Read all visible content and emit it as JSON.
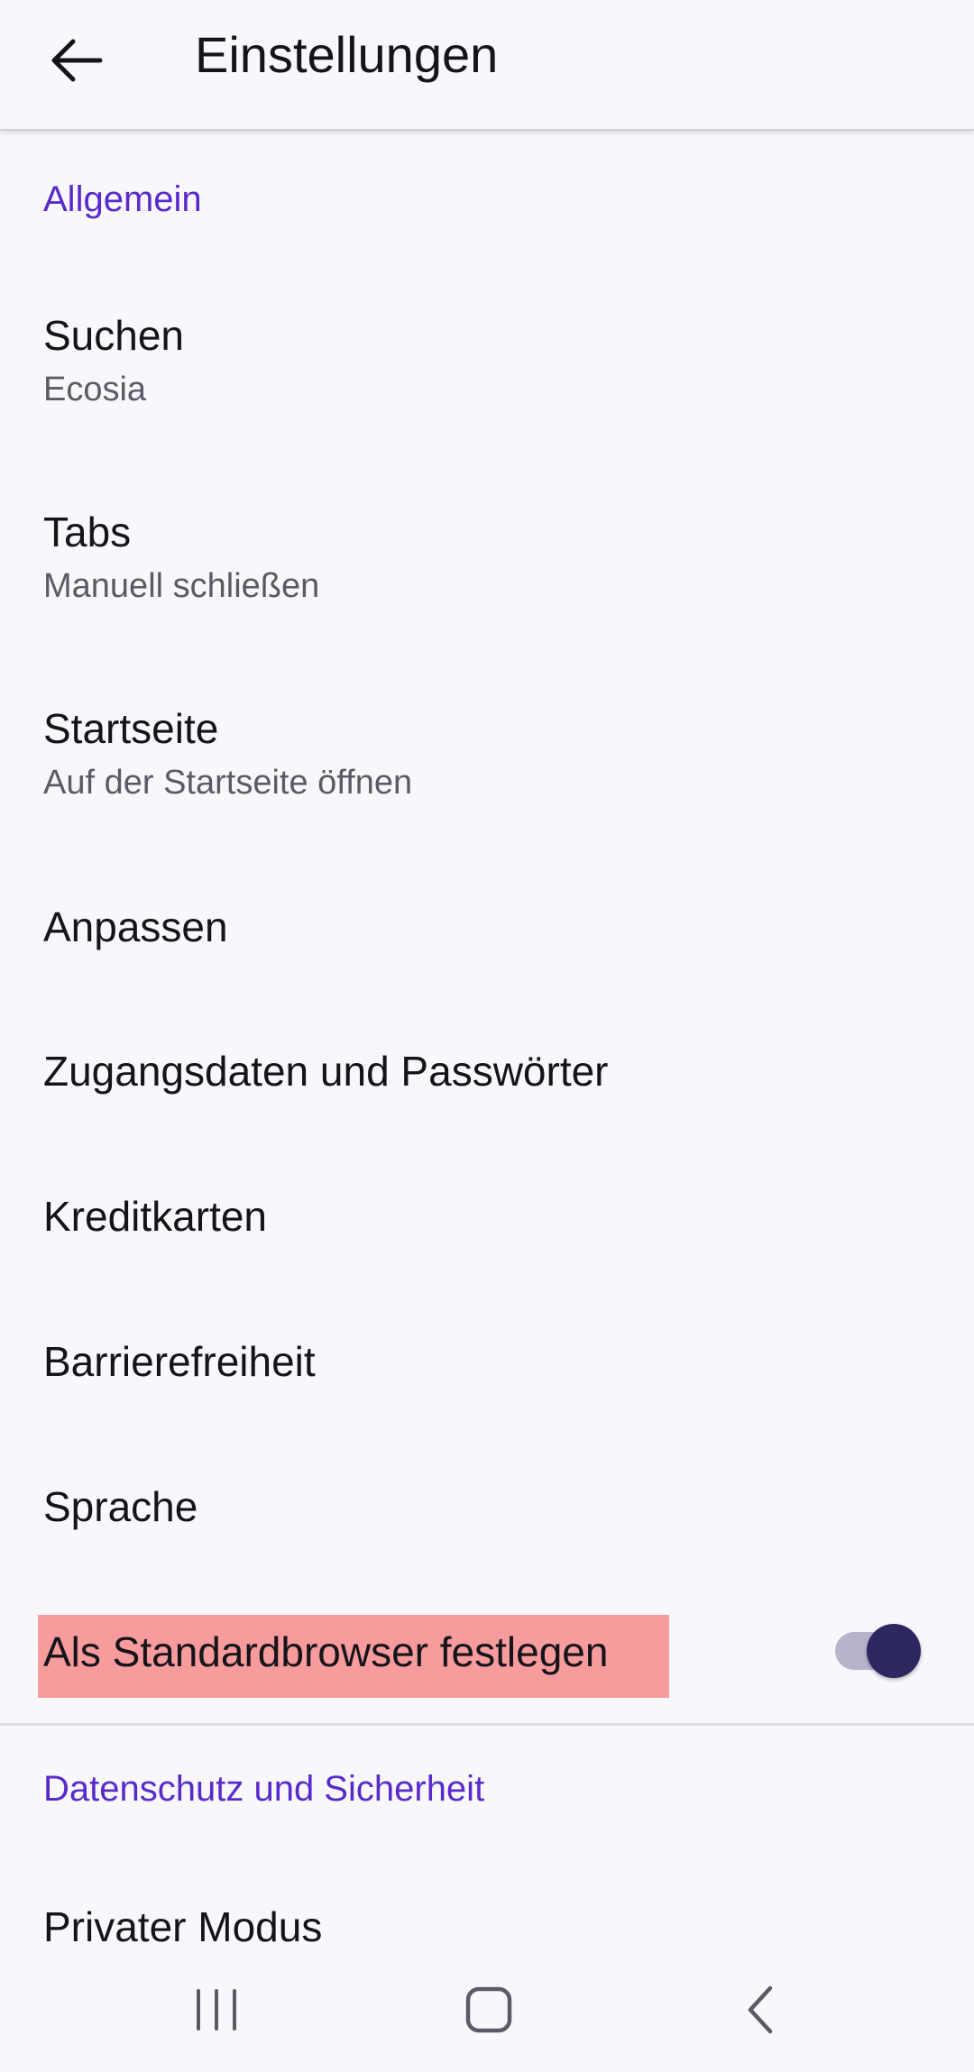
{
  "app_bar": {
    "title": "Einstellungen",
    "back_icon": "arrow-left-icon"
  },
  "sections": [
    {
      "header": "Allgemein",
      "items": [
        {
          "title": "Suchen",
          "summary": "Ecosia"
        },
        {
          "title": "Tabs",
          "summary": "Manuell schließen"
        },
        {
          "title": "Startseite",
          "summary": "Auf der Startseite öffnen"
        },
        {
          "title": "Anpassen"
        },
        {
          "title": "Zugangsdaten und Passwörter"
        },
        {
          "title": "Kreditkarten"
        },
        {
          "title": "Barrierefreiheit"
        },
        {
          "title": "Sprache"
        },
        {
          "title": "Als Standardbrowser festlegen",
          "toggle": true,
          "toggle_state": "on",
          "highlighted": true
        }
      ]
    },
    {
      "header": "Datenschutz und Sicherheit",
      "items": [
        {
          "title": "Privater Modus"
        }
      ]
    }
  ],
  "colors": {
    "accent": "#592acb",
    "highlight": "#f89b9d",
    "switch_thumb": "#2d2761",
    "switch_track": "#b7b4cc",
    "background": "#f8f8fc"
  },
  "system_nav": {
    "recents_icon": "recents-icon",
    "home_icon": "home-icon",
    "back_icon": "chevron-left-icon"
  }
}
